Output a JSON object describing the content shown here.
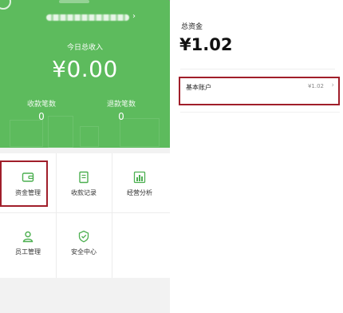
{
  "left_panel": {
    "merchant_chevron": "›",
    "today_label": "今日总收入",
    "today_amount": "¥0.00",
    "stats": [
      {
        "label": "收款笔数",
        "value": "0"
      },
      {
        "label": "退款笔数",
        "value": "0"
      }
    ],
    "menu": [
      {
        "label": "资金管理",
        "icon": "wallet-icon"
      },
      {
        "label": "收款记录",
        "icon": "document-icon"
      },
      {
        "label": "经营分析",
        "icon": "bar-chart-icon"
      },
      {
        "label": "员工管理",
        "icon": "person-icon"
      },
      {
        "label": "安全中心",
        "icon": "shield-icon"
      }
    ],
    "accent_color": "#5dbb5d",
    "highlight_color": "#a01e2a"
  },
  "right_panel": {
    "total_label": "总资金",
    "total_amount": "¥1.02",
    "accounts": [
      {
        "name": "基本账户",
        "amount": "¥1.02",
        "chevron": "›"
      }
    ]
  }
}
